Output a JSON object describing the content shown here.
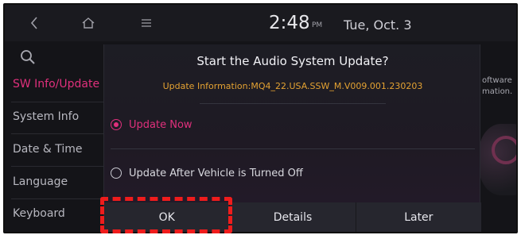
{
  "status_bar": {
    "back_icon": "back-chevron-icon",
    "home_icon": "home-icon",
    "menu_icon": "menu-icon",
    "time": "2:48",
    "ampm": "PM",
    "date": "Tue, Oct. 3"
  },
  "sidebar": {
    "search_icon": "search-icon",
    "items": [
      {
        "label": "SW Info/Update",
        "active": true
      },
      {
        "label": "System Info",
        "active": false
      },
      {
        "label": "Date & Time",
        "active": false
      },
      {
        "label": "Language",
        "active": false
      },
      {
        "label": "Keyboard",
        "active": false
      }
    ]
  },
  "background_text": {
    "line1": "oftware",
    "line2": "mation."
  },
  "dialog": {
    "title": "Start the Audio System Update?",
    "info": "Update Information:MQ4_22.USA.SSW_M.V009.001.230203",
    "options": [
      {
        "label": "Update Now",
        "selected": true
      },
      {
        "label": "Update After Vehicle is Turned Off",
        "selected": false
      }
    ],
    "buttons": {
      "ok": "OK",
      "details": "Details",
      "later": "Later"
    }
  },
  "colors": {
    "accent": "#e0307c",
    "info_text": "#e4a232",
    "annotation": "#ef1c1c"
  }
}
